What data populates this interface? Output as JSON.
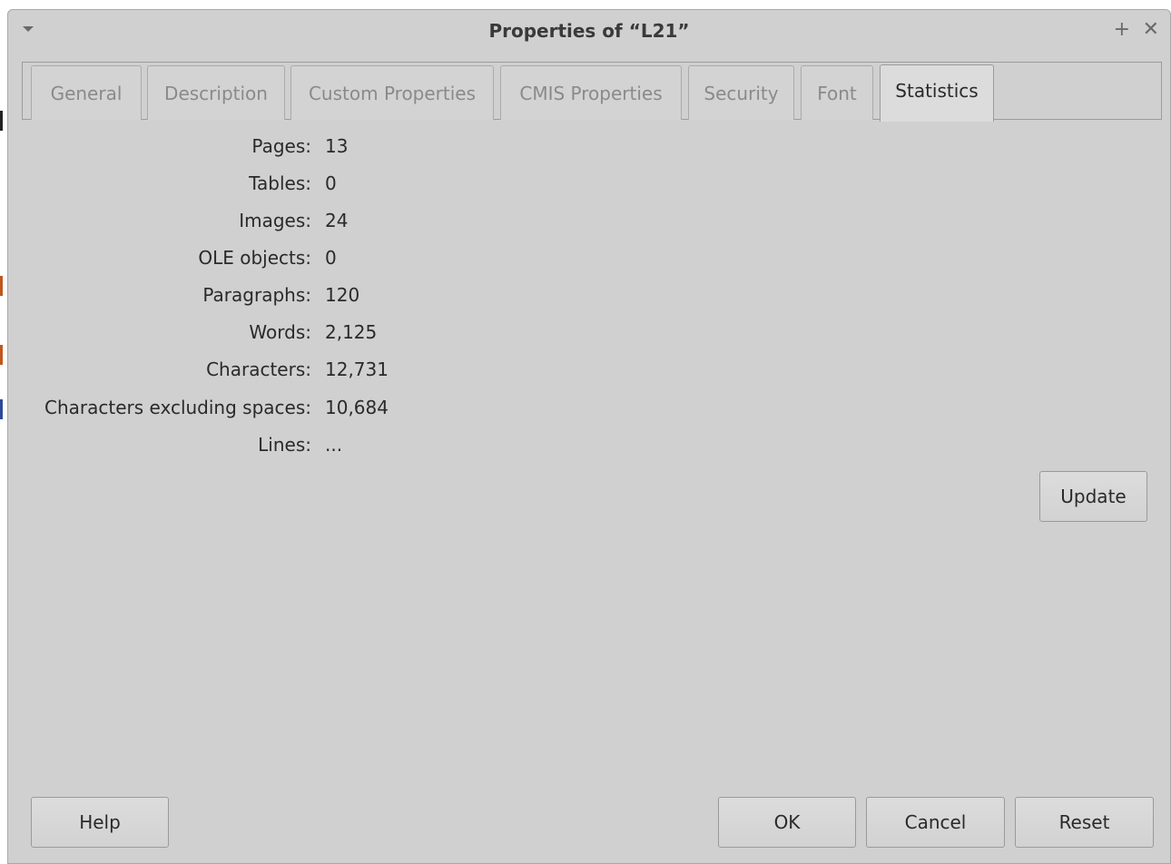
{
  "window": {
    "title": "Properties of “L21”",
    "maximize_glyph": "+",
    "close_glyph": "✕"
  },
  "tabs": [
    {
      "label": "General",
      "active": false
    },
    {
      "label": "Description",
      "active": false
    },
    {
      "label": "Custom Properties",
      "active": false
    },
    {
      "label": "CMIS Properties",
      "active": false
    },
    {
      "label": "Security",
      "active": false
    },
    {
      "label": "Font",
      "active": false
    },
    {
      "label": "Statistics",
      "active": true
    }
  ],
  "statistics": {
    "rows": [
      {
        "label": "Pages:",
        "value": "13"
      },
      {
        "label": "Tables:",
        "value": "0"
      },
      {
        "label": "Images:",
        "value": "24"
      },
      {
        "label": "OLE objects:",
        "value": "0"
      },
      {
        "label": "Paragraphs:",
        "value": "120"
      },
      {
        "label": "Words:",
        "value": "2,125"
      },
      {
        "label": "Characters:",
        "value": "12,731"
      },
      {
        "label": "Characters excluding spaces:",
        "value": "10,684"
      },
      {
        "label": "Lines:",
        "value": "..."
      }
    ],
    "update_label": "Update"
  },
  "footer": {
    "help_label": "Help",
    "ok_label": "OK",
    "cancel_label": "Cancel",
    "reset_label": "Reset"
  },
  "colors": {
    "dialog_bg": "#d0d0d0",
    "text": "#2a2a2a",
    "inactive_tab_text": "#8a8a8a"
  }
}
